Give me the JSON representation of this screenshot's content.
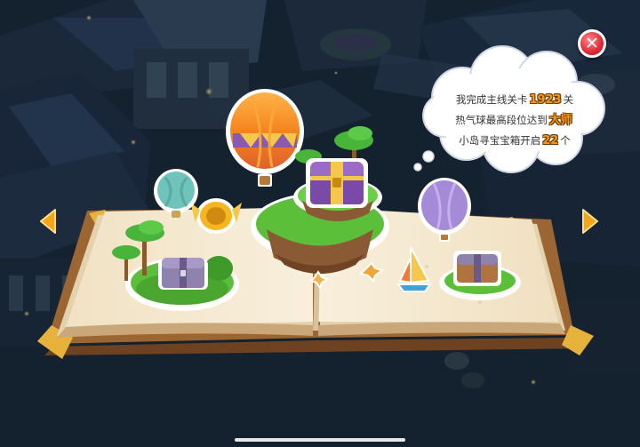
{
  "achievement": {
    "line1_prefix": "我完成主线关卡",
    "line1_value": "1923",
    "line1_suffix": "关",
    "line2_prefix": "热气球最高段位达到",
    "line2_value": "大师",
    "line3_prefix": "小岛寻宝宝箱开启",
    "line3_value": "22",
    "line3_suffix": "个"
  },
  "controls": {
    "close_symbol": "✕"
  },
  "colors": {
    "highlight": "#f39a1a",
    "close_button": "#e02a36",
    "page": "#f6ecd6",
    "book_cover": "#a26a36",
    "grass": "#5cbf3a"
  }
}
